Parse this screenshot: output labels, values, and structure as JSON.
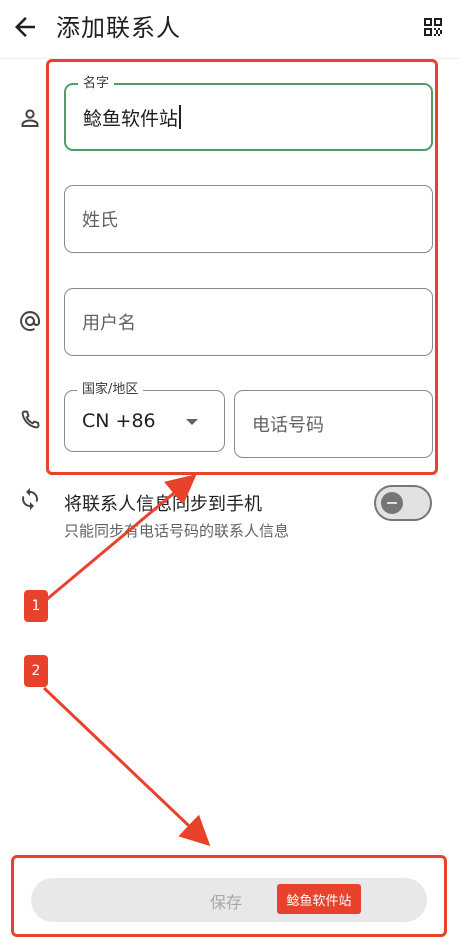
{
  "header": {
    "title": "添加联系人",
    "back_icon": "arrow-back-icon",
    "qr_icon": "qr-code-icon"
  },
  "form": {
    "first_name": {
      "label": "名字",
      "value": "鲶鱼软件站"
    },
    "last_name": {
      "placeholder": "姓氏"
    },
    "username": {
      "placeholder": "用户名"
    },
    "country": {
      "label": "国家/地区",
      "value": "CN +86"
    },
    "phone": {
      "placeholder": "电话号码"
    }
  },
  "sync": {
    "title": "将联系人信息同步到手机",
    "subtitle": "只能同步有电话号码的联系人信息",
    "toggle_on": false,
    "icon": "sync-icon"
  },
  "annotations": {
    "badge1": "1",
    "badge2": "2",
    "color": "#e8422c"
  },
  "footer": {
    "save_label": "保存",
    "watermark": "鲶鱼软件站"
  },
  "colors": {
    "focus": "#4f9d69",
    "annotation": "#e8422c",
    "outline": "#8a8a8a"
  }
}
